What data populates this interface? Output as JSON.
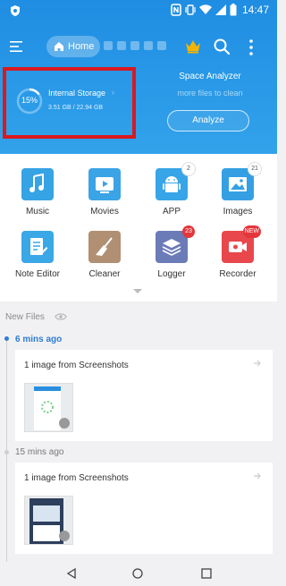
{
  "status_bar": {
    "time": "14:47"
  },
  "header": {
    "home_label": "Home"
  },
  "storage": {
    "percent_label": "15%",
    "percent_used": 15,
    "title": "Internal Storage",
    "size": "3.51 GB / 22.94 GB"
  },
  "analyzer": {
    "title": "Space Analyzer",
    "subtitle": "more files to clean",
    "button_label": "Analyze"
  },
  "categories": [
    {
      "label": "Music",
      "icon": "music-icon",
      "color": "#35a3e4"
    },
    {
      "label": "Movies",
      "icon": "movie-icon",
      "color": "#3aa4e6"
    },
    {
      "label": "APP",
      "icon": "android-icon",
      "color": "#37a5e7",
      "badge": "2"
    },
    {
      "label": "Images",
      "icon": "image-icon",
      "color": "#34a0e3",
      "badge": "21"
    },
    {
      "label": "Note Editor",
      "icon": "note-icon",
      "color": "#3aa7e6"
    },
    {
      "label": "Cleaner",
      "icon": "broom-icon",
      "color": "#b08f72"
    },
    {
      "label": "Logger",
      "icon": "layers-icon",
      "color": "#6b7bb8",
      "badge": "23"
    },
    {
      "label": "Recorder",
      "icon": "camera-icon",
      "color": "#e8474c",
      "badge": "NEW"
    }
  ],
  "new_files": {
    "title": "New Files",
    "groups": [
      {
        "time": "6 mins ago",
        "title": "1 image from Screenshots"
      },
      {
        "time": "15 mins ago",
        "title": "1 image from Screenshots"
      }
    ]
  },
  "colors": {
    "accent": "#1f8de2",
    "highlight_border": "#d9191f",
    "timeline_active": "#2f7bd6"
  }
}
